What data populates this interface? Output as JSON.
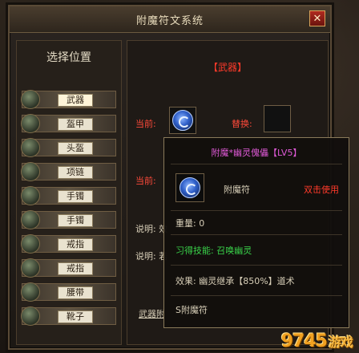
{
  "window": {
    "title": "附魔符文系统",
    "close_glyph": "✕"
  },
  "left_panel": {
    "header": "选择位置",
    "slots": [
      {
        "label": "武器",
        "selected": true
      },
      {
        "label": "盔甲",
        "selected": false
      },
      {
        "label": "头盔",
        "selected": false
      },
      {
        "label": "项链",
        "selected": false
      },
      {
        "label": "手镯",
        "selected": false
      },
      {
        "label": "手镯",
        "selected": false
      },
      {
        "label": "戒指",
        "selected": false
      },
      {
        "label": "戒指",
        "selected": false
      },
      {
        "label": "腰带",
        "selected": false
      },
      {
        "label": "靴子",
        "selected": false
      }
    ]
  },
  "right_panel": {
    "weapon_title": "【武器】",
    "current_label": "当前:",
    "replace_label": "替换:",
    "current_label_2": "当前:",
    "desc_label_1": "说明: 效",
    "desc_label_2": "说明: 若",
    "weapon_link": "武器附"
  },
  "tooltip": {
    "title": "附魔*幽灵傀儡【LV5】",
    "item_name": "附魔符",
    "use_hint": "双击使用",
    "weight": "重量: 0",
    "skill": "习得技能: 召唤幽灵",
    "effect": "效果: 幽灵继承【850%】道术",
    "type": "S附魔符"
  },
  "watermark": {
    "text": "9745",
    "sub": "游戏"
  },
  "colors": {
    "accent_red": "#ff3a2a",
    "magenta": "#e05ad8",
    "green": "#39d34a",
    "gold": "#f0a020"
  }
}
